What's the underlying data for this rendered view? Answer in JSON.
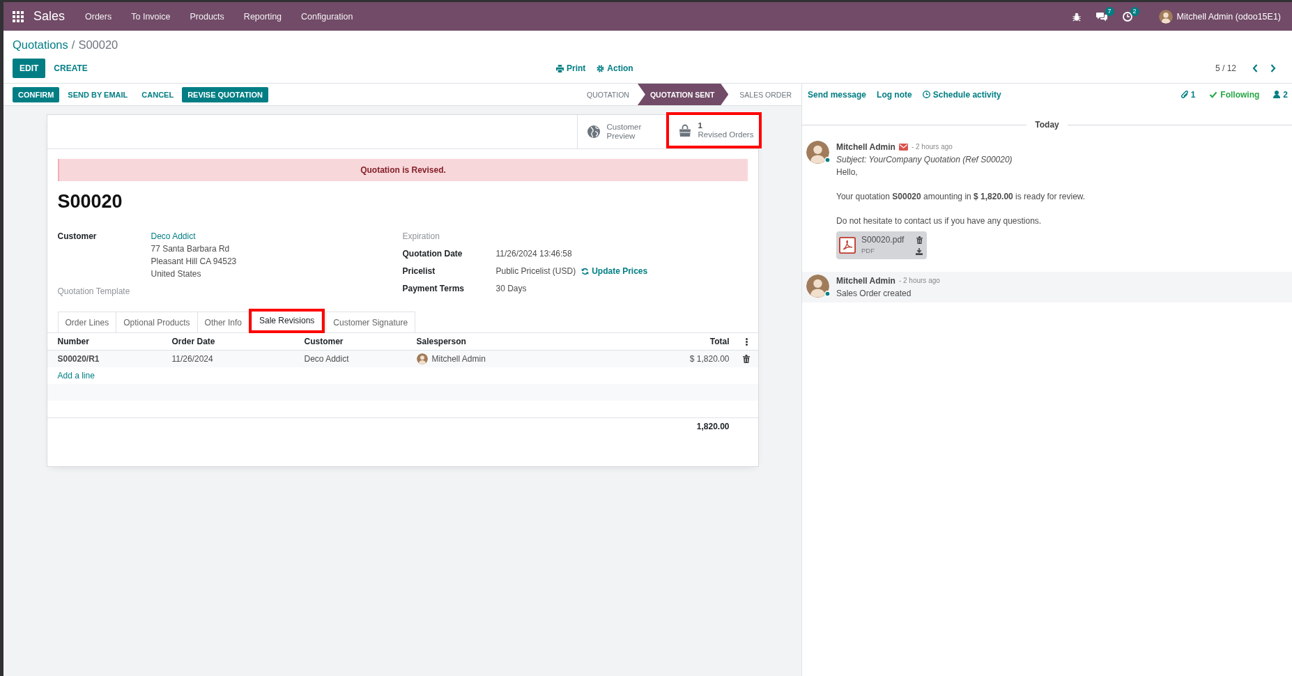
{
  "navbar": {
    "app_name": "Sales",
    "menu": [
      "Orders",
      "To Invoice",
      "Products",
      "Reporting",
      "Configuration"
    ],
    "systray": [
      {
        "kind": "debug"
      },
      {
        "kind": "messages",
        "badge": "7"
      },
      {
        "kind": "activities",
        "badge": "2"
      }
    ],
    "user": "Mitchell Admin (odoo15E1)"
  },
  "breadcrumb": {
    "parent": "Quotations",
    "separator": "/",
    "current": "S00020"
  },
  "control_buttons": [
    {
      "label": "EDIT",
      "primary": true
    },
    {
      "label": "CREATE",
      "primary": false
    }
  ],
  "actions": [
    {
      "kind": "print",
      "label": "Print"
    },
    {
      "kind": "action",
      "label": "Action"
    }
  ],
  "pager": "5 / 12",
  "header_buttons": [
    {
      "label": "CONFIRM",
      "primary": true
    },
    {
      "label": "SEND BY EMAIL",
      "primary": false
    },
    {
      "label": "CANCEL",
      "primary": false
    },
    {
      "label": "REVISE QUOTATION",
      "primary": true
    }
  ],
  "statusbar": [
    {
      "label": "QUOTATION",
      "selected": false
    },
    {
      "label": "QUOTATION SENT",
      "selected": true
    },
    {
      "label": "SALES ORDER",
      "selected": false
    }
  ],
  "sheet": {
    "stat_buttons": [
      {
        "kind": "globe",
        "label": "Customer Preview",
        "highlighted": false
      },
      {
        "kind": "bag",
        "value": "1",
        "label": "Revised Orders",
        "highlighted": true
      }
    ],
    "alert": "Quotation is Revised.",
    "title": "S00020",
    "left_group": [
      {
        "label": "Customer",
        "empty": false,
        "value": "Deco Addict",
        "link": true,
        "address": [
          "77 Santa Barbara Rd",
          "Pleasant Hill CA 94523",
          "United States"
        ]
      },
      {
        "label": "Quotation Template",
        "empty": true
      }
    ],
    "right_group": [
      {
        "label": "Expiration",
        "empty": true
      },
      {
        "label": "Quotation Date",
        "empty": false,
        "value": "11/26/2024 13:46:58",
        "link": false
      },
      {
        "label": "Pricelist",
        "empty": false,
        "value": "Public Pricelist (USD)",
        "link": false,
        "button": "Update Prices"
      },
      {
        "label": "Payment Terms",
        "empty": false,
        "value": "30 Days",
        "link": false
      }
    ],
    "tabs": [
      {
        "label": "Order Lines",
        "selected": false,
        "highlighted": false
      },
      {
        "label": "Optional Products",
        "selected": false,
        "highlighted": false
      },
      {
        "label": "Other Info",
        "selected": false,
        "highlighted": false
      },
      {
        "label": "Sale Revisions",
        "selected": true,
        "highlighted": true
      },
      {
        "label": "Customer Signature",
        "selected": false,
        "highlighted": false
      }
    ],
    "table": {
      "columns": [
        {
          "label": "Number",
          "kind": "name"
        },
        {
          "label": "Order Date",
          "kind": "text"
        },
        {
          "label": "Customer",
          "kind": "text"
        },
        {
          "label": "Salesperson",
          "kind": "user"
        },
        {
          "label": "Total",
          "kind": "monetary"
        }
      ],
      "rows": [
        [
          "S00020/R1",
          "11/26/2024",
          "Deco Addict",
          "Mitchell Admin",
          "$ 1,820.00"
        ]
      ],
      "add_line": "Add a line",
      "total": "1,820.00"
    }
  },
  "chatter": {
    "actions": [
      {
        "kind": "plain",
        "label": "Send message"
      },
      {
        "kind": "plain",
        "label": "Log note"
      },
      {
        "kind": "clock",
        "label": "Schedule activity"
      }
    ],
    "indicators": [
      {
        "kind": "attachments",
        "label": "1"
      },
      {
        "kind": "following",
        "label": "Following"
      },
      {
        "kind": "followers",
        "label": "2"
      }
    ],
    "date_separator": "Today",
    "messages": [
      {
        "author": "Mitchell Admin",
        "email": true,
        "time": "- 2 hours ago",
        "subject": "Subject: YourCompany Quotation (Ref S00020)",
        "body": [
          "Hello,",
          "Your quotation **S00020** amounting in **$ 1,820.00** is ready for review.",
          "Do not hesitate to contact us if you have any questions."
        ],
        "attachments": [
          {
            "name": "S00020.pdf",
            "type": "PDF"
          }
        ],
        "shaded": false
      },
      {
        "author": "Mitchell Admin",
        "email": false,
        "time": "- 2 hours ago",
        "body": [
          "Sales Order created"
        ],
        "shaded": true
      }
    ]
  }
}
